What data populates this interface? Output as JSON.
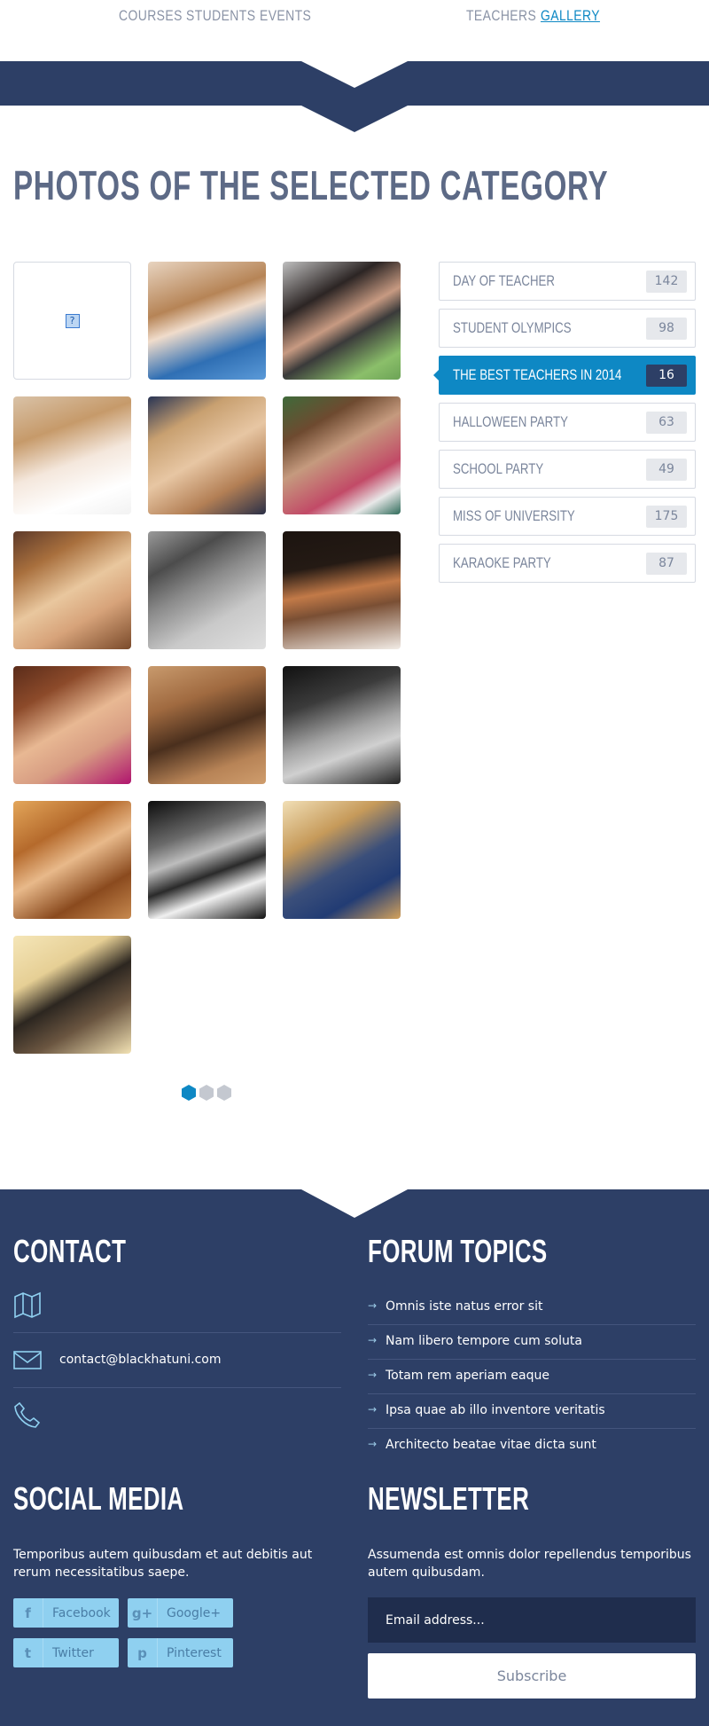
{
  "nav": {
    "items": [
      {
        "label": "COURSES",
        "active": false
      },
      {
        "label": "STUDENTS",
        "active": false
      },
      {
        "label": "EVENTS",
        "active": false
      },
      {
        "label": "TEACHERS",
        "active": false
      },
      {
        "label": "GALLERY",
        "active": true
      }
    ]
  },
  "page_title": "PHOTOS OF THE SELECTED CATEGORY",
  "gallery": {
    "placeholder_glyph": "?",
    "photo_count": 16
  },
  "pagination": {
    "pages": 3,
    "current": 1
  },
  "categories": [
    {
      "label": "DAY OF TEACHER",
      "count": "142",
      "active": false
    },
    {
      "label": "STUDENT OLYMPICS",
      "count": "98",
      "active": false
    },
    {
      "label": "THE BEST TEACHERS IN 2014",
      "count": "16",
      "active": true
    },
    {
      "label": "HALLOWEEN PARTY",
      "count": "63",
      "active": false
    },
    {
      "label": "SCHOOL PARTY",
      "count": "49",
      "active": false
    },
    {
      "label": "MISS OF UNIVERSITY",
      "count": "175",
      "active": false
    },
    {
      "label": "KARAOKE PARTY",
      "count": "87",
      "active": false
    }
  ],
  "footer": {
    "contact": {
      "title": "CONTACT",
      "email": "contact@blackhatuni.com"
    },
    "forum": {
      "title": "FORUM TOPICS",
      "topics": [
        "Omnis iste natus error sit",
        "Nam libero tempore cum soluta",
        "Totam rem aperiam eaque",
        "Ipsa quae ab illo inventore veritatis",
        "Architecto beatae vitae dicta sunt"
      ]
    },
    "social": {
      "title": "SOCIAL MEDIA",
      "text": "Temporibus autem quibusdam et aut debitis aut rerum necessitatibus saepe.",
      "buttons": [
        {
          "label": "Facebook",
          "glyph": "f"
        },
        {
          "label": "Google+",
          "glyph": "g+"
        },
        {
          "label": "Twitter",
          "glyph": "t"
        },
        {
          "label": "Pinterest",
          "glyph": "p"
        }
      ]
    },
    "newsletter": {
      "title": "NEWSLETTER",
      "text": "Assumenda est omnis dolor repellendus temporibus autem quibusdam.",
      "email_placeholder": "Email address...",
      "subscribe_label": "Subscribe"
    }
  },
  "colors": {
    "navy": "#2d3f66",
    "accent": "#0e88c4",
    "muted_text": "#7b869c",
    "social_button": "#8fd0f0"
  }
}
